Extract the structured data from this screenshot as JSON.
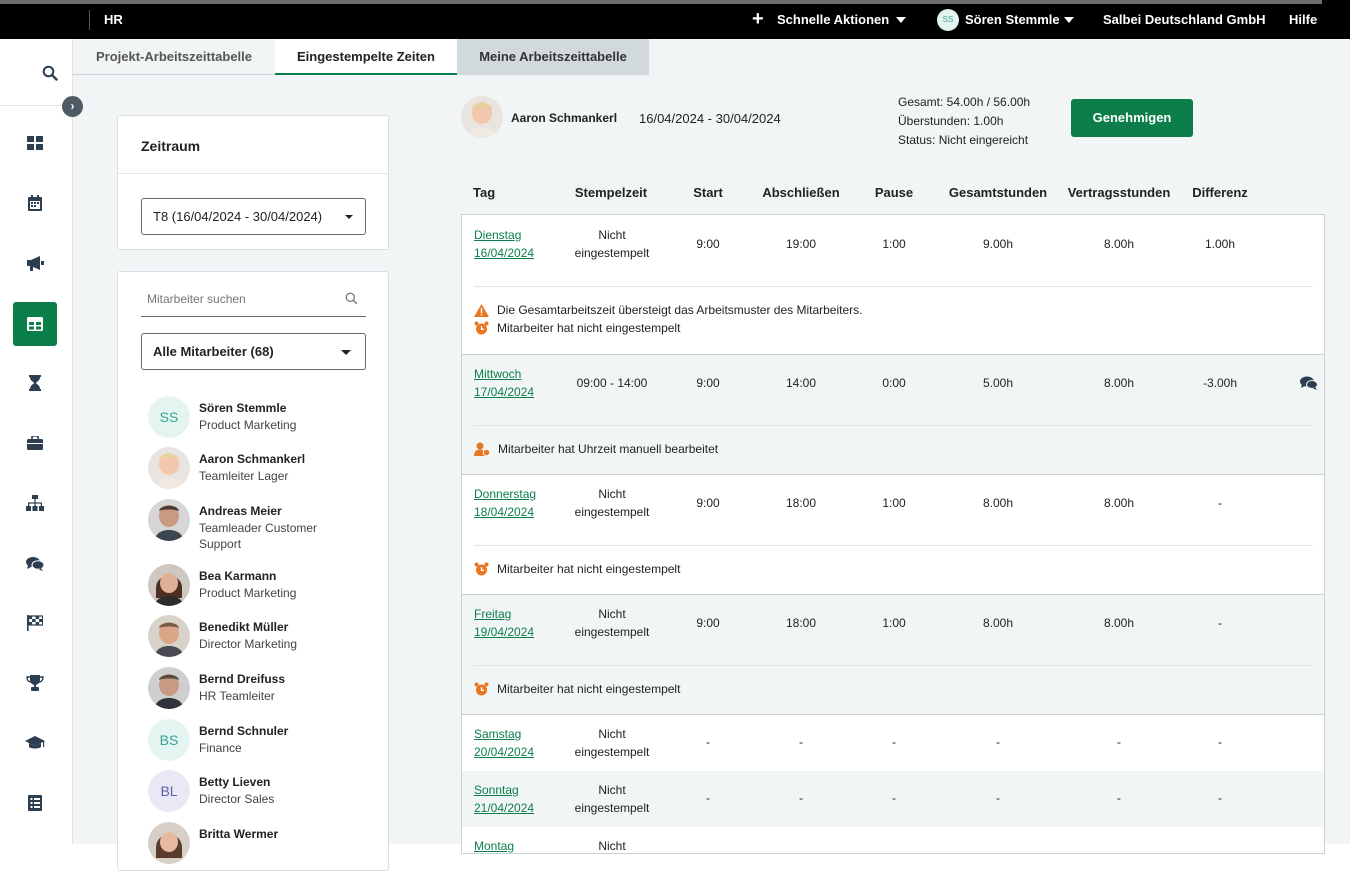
{
  "topbar": {
    "app": "HR",
    "quick_actions": "Schnelle Aktionen",
    "user_initials": "SS",
    "user_name": "Sören Stemmle",
    "company": "Salbei Deutschland GmbH",
    "help": "Hilfe"
  },
  "sidebar": {
    "icons": [
      "search-icon",
      "dashboard-icon",
      "calendar-icon",
      "megaphone-icon",
      "table-icon",
      "hourglass-icon",
      "briefcase-icon",
      "org-chart-icon",
      "chat-icon",
      "flag-icon",
      "trophy-icon",
      "graduation-cap-icon",
      "checklist-icon"
    ],
    "active": "table-icon",
    "accent": "#0b7e49"
  },
  "tabs": [
    {
      "label": "Projekt-Arbeitszeittabelle"
    },
    {
      "label": "Eingestempelte Zeiten"
    },
    {
      "label": "Meine Arbeitszeittabelle"
    }
  ],
  "period": {
    "title": "Zeitraum",
    "selected": "T8 (16/04/2024 - 30/04/2024)"
  },
  "employees": {
    "search_placeholder": "Mitarbeiter suchen",
    "filter": "Alle Mitarbeiter (68)",
    "list": [
      {
        "initials": "SS",
        "name": "Sören Stemmle",
        "role": "Product Marketing"
      },
      {
        "initials": "",
        "name": "Aaron Schmankerl",
        "role": "Teamleiter Lager"
      },
      {
        "initials": "",
        "name": "Andreas Meier",
        "role": "Teamleader Customer Support"
      },
      {
        "initials": "",
        "name": "Bea Karmann",
        "role": "Product Marketing"
      },
      {
        "initials": "",
        "name": "Benedikt Müller",
        "role": "Director Marketing"
      },
      {
        "initials": "",
        "name": "Bernd Dreifuss",
        "role": "HR Teamleiter"
      },
      {
        "initials": "BS",
        "name": "Bernd Schnuler",
        "role": "Finance"
      },
      {
        "initials": "BL",
        "name": "Betty Lieven",
        "role": "Director Sales"
      },
      {
        "initials": "",
        "name": "Britta Wermer",
        "role": ""
      }
    ]
  },
  "summary": {
    "employee": "Aaron Schmankerl",
    "range": "16/04/2024 - 30/04/2024",
    "total": "Gesamt: 54.00h / 56.00h",
    "overtime": "Überstunden: 1.00h",
    "status": "Status: Nicht eingereicht",
    "approve": "Genehmigen"
  },
  "table": {
    "headers": [
      "Tag",
      "Stempelzeit",
      "Start",
      "Abschließen",
      "Pause",
      "Gesamtstunden",
      "Vertragsstunden",
      "Differenz"
    ],
    "rows": [
      {
        "day": "Dienstag",
        "date": "16/04/2024",
        "clock1": "Nicht",
        "clock2": "eingestempelt",
        "start": "9:00",
        "end": "19:00",
        "pause": "1:00",
        "total": "9.00h",
        "contract": "8.00h",
        "diff": "1.00h",
        "messages": [
          "Die Gesamtarbeitszeit übersteigt das Arbeitsmuster des Mitarbeiters.",
          "Mitarbeiter hat nicht eingestempelt"
        ]
      },
      {
        "day": "Mittwoch",
        "date": "17/04/2024",
        "clock1": "09:00 - 14:00",
        "clock2": "",
        "start": "9:00",
        "end": "14:00",
        "pause": "0:00",
        "total": "5.00h",
        "contract": "8.00h",
        "diff": "-3.00h",
        "messages": [
          "Mitarbeiter hat Uhrzeit manuell bearbeitet"
        ]
      },
      {
        "day": "Donnerstag",
        "date": "18/04/2024",
        "clock1": "Nicht",
        "clock2": "eingestempelt",
        "start": "9:00",
        "end": "18:00",
        "pause": "1:00",
        "total": "8.00h",
        "contract": "8.00h",
        "diff": "-",
        "messages": [
          "Mitarbeiter hat nicht eingestempelt"
        ]
      },
      {
        "day": "Freitag",
        "date": "19/04/2024",
        "clock1": "Nicht",
        "clock2": "eingestempelt",
        "start": "9:00",
        "end": "18:00",
        "pause": "1:00",
        "total": "8.00h",
        "contract": "8.00h",
        "diff": "-",
        "messages": [
          "Mitarbeiter hat nicht eingestempelt"
        ]
      },
      {
        "day": "Samstag",
        "date": "20/04/2024",
        "clock1": "Nicht",
        "clock2": "eingestempelt",
        "start": "-",
        "end": "-",
        "pause": "-",
        "total": "-",
        "contract": "-",
        "diff": "-"
      },
      {
        "day": "Sonntag",
        "date": "21/04/2024",
        "clock1": "Nicht",
        "clock2": "eingestempelt",
        "start": "-",
        "end": "-",
        "pause": "-",
        "total": "-",
        "contract": "-",
        "diff": "-"
      },
      {
        "day": "Montag",
        "date": "",
        "clock1": "Nicht",
        "clock2": "",
        "start": "",
        "end": "",
        "pause": "",
        "total": "",
        "contract": "",
        "diff": ""
      }
    ]
  }
}
